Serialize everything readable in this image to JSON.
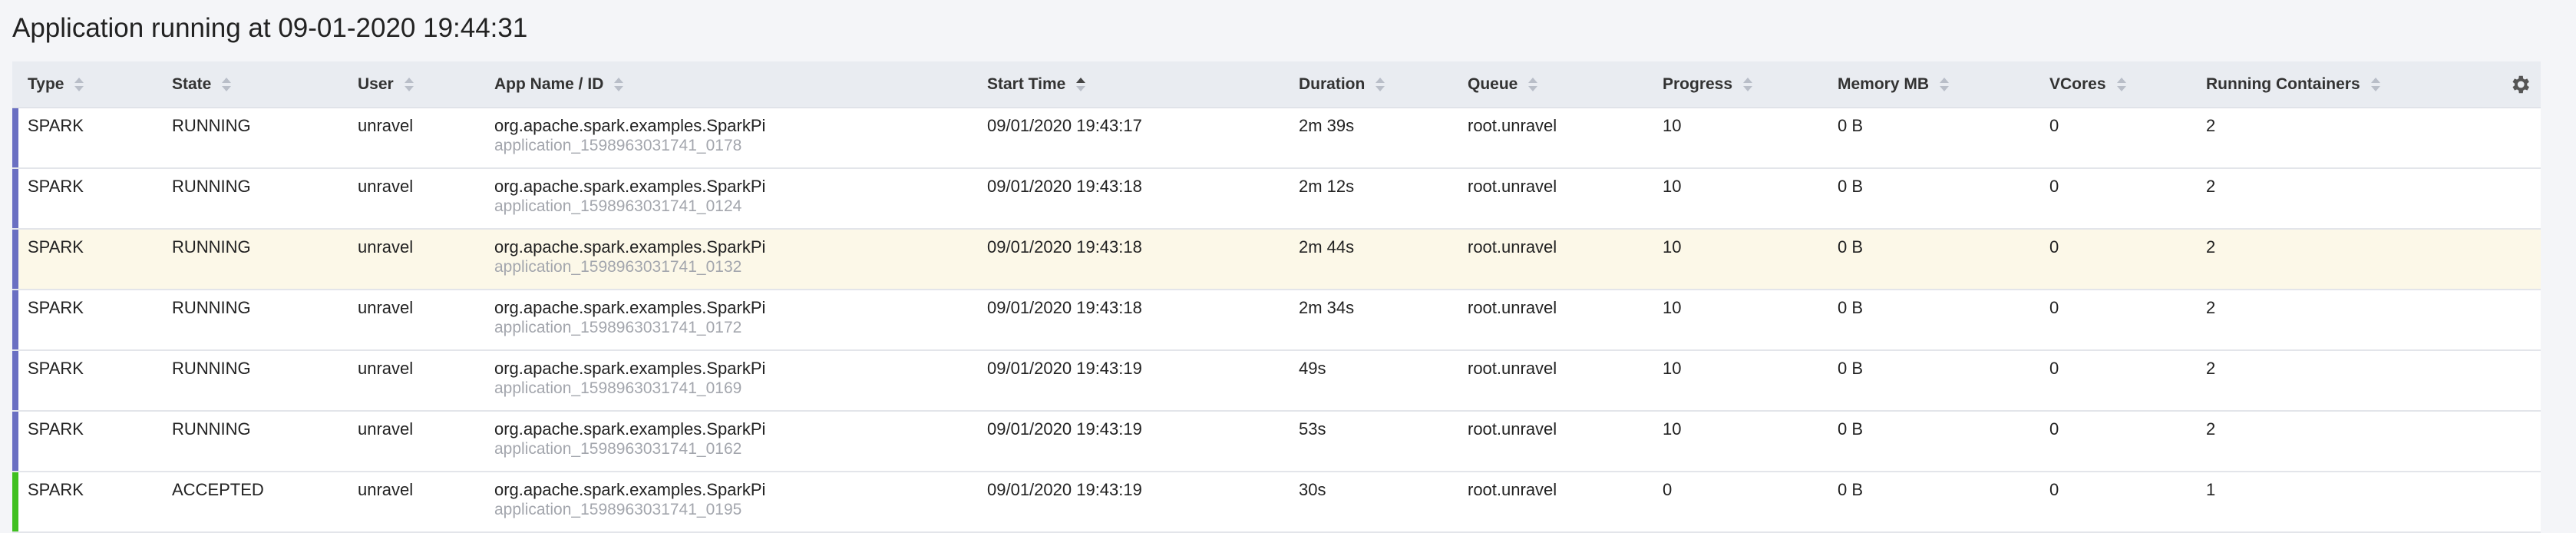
{
  "page": {
    "title": "Application running at 09-01-2020 19:44:31"
  },
  "table": {
    "columns": [
      {
        "key": "type",
        "label": "Type"
      },
      {
        "key": "state",
        "label": "State"
      },
      {
        "key": "user",
        "label": "User"
      },
      {
        "key": "app",
        "label": "App Name / ID"
      },
      {
        "key": "start",
        "label": "Start Time"
      },
      {
        "key": "duration",
        "label": "Duration"
      },
      {
        "key": "queue",
        "label": "Queue"
      },
      {
        "key": "progress",
        "label": "Progress"
      },
      {
        "key": "memory",
        "label": "Memory MB"
      },
      {
        "key": "vcores",
        "label": "VCores"
      },
      {
        "key": "containers",
        "label": "Running Containers"
      }
    ],
    "sorted_column": "start",
    "settings_icon": "gear-icon",
    "state_colors": {
      "RUNNING": "#6a6fc2",
      "ACCEPTED": "#3fc01f"
    },
    "highlight_color": "#fcf8e8",
    "rows": [
      {
        "type": "SPARK",
        "state": "RUNNING",
        "user": "unravel",
        "app_name": "org.apache.spark.examples.SparkPi",
        "app_id": "application_1598963031741_0178",
        "start": "09/01/2020 19:43:17",
        "duration": "2m 39s",
        "queue": "root.unravel",
        "progress": "10",
        "memory": "0 B",
        "vcores": "0",
        "containers": "2"
      },
      {
        "type": "SPARK",
        "state": "RUNNING",
        "user": "unravel",
        "app_name": "org.apache.spark.examples.SparkPi",
        "app_id": "application_1598963031741_0124",
        "start": "09/01/2020 19:43:18",
        "duration": "2m 12s",
        "queue": "root.unravel",
        "progress": "10",
        "memory": "0 B",
        "vcores": "0",
        "containers": "2"
      },
      {
        "type": "SPARK",
        "state": "RUNNING",
        "user": "unravel",
        "app_name": "org.apache.spark.examples.SparkPi",
        "app_id": "application_1598963031741_0132",
        "start": "09/01/2020 19:43:18",
        "duration": "2m 44s",
        "queue": "root.unravel",
        "progress": "10",
        "memory": "0 B",
        "vcores": "0",
        "containers": "2"
      },
      {
        "type": "SPARK",
        "state": "RUNNING",
        "user": "unravel",
        "app_name": "org.apache.spark.examples.SparkPi",
        "app_id": "application_1598963031741_0172",
        "start": "09/01/2020 19:43:18",
        "duration": "2m 34s",
        "queue": "root.unravel",
        "progress": "10",
        "memory": "0 B",
        "vcores": "0",
        "containers": "2"
      },
      {
        "type": "SPARK",
        "state": "RUNNING",
        "user": "unravel",
        "app_name": "org.apache.spark.examples.SparkPi",
        "app_id": "application_1598963031741_0169",
        "start": "09/01/2020 19:43:19",
        "duration": "49s",
        "queue": "root.unravel",
        "progress": "10",
        "memory": "0 B",
        "vcores": "0",
        "containers": "2"
      },
      {
        "type": "SPARK",
        "state": "RUNNING",
        "user": "unravel",
        "app_name": "org.apache.spark.examples.SparkPi",
        "app_id": "application_1598963031741_0162",
        "start": "09/01/2020 19:43:19",
        "duration": "53s",
        "queue": "root.unravel",
        "progress": "10",
        "memory": "0 B",
        "vcores": "0",
        "containers": "2"
      },
      {
        "type": "SPARK",
        "state": "ACCEPTED",
        "user": "unravel",
        "app_name": "org.apache.spark.examples.SparkPi",
        "app_id": "application_1598963031741_0195",
        "start": "09/01/2020 19:43:19",
        "duration": "30s",
        "queue": "root.unravel",
        "progress": "0",
        "memory": "0 B",
        "vcores": "0",
        "containers": "1"
      }
    ]
  }
}
